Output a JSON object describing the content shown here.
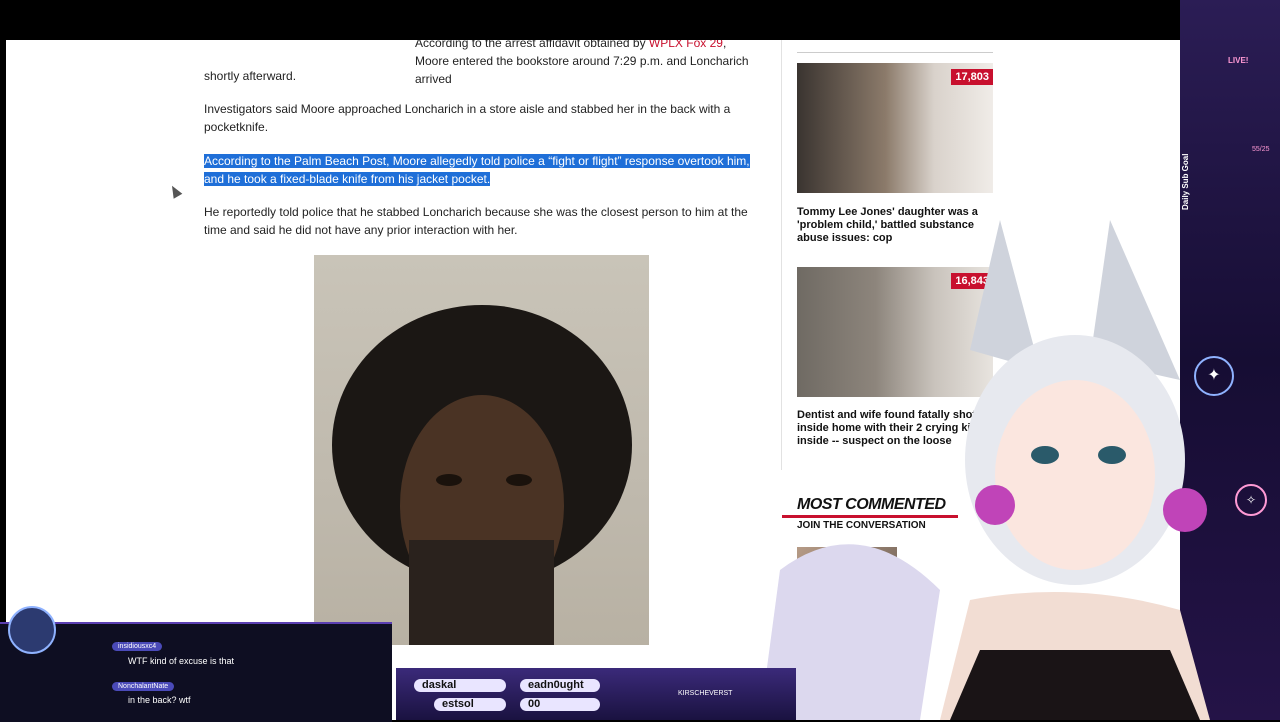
{
  "article": {
    "intro_prefix": "According to the arrest affidavit obtained by ",
    "intro_source": "WPLX Fox 29",
    "intro_middle": ", Moore entered the bookstore around 7:29 p.m. and Loncharich arrived",
    "intro_end": "shortly afterward.",
    "p2": "Investigators said Moore approached Loncharich in a store aisle and stabbed her in the back with a pocketknife.",
    "p3_line1": "According to the Palm Beach Post, Moore allegedly told police a “fight or flight” response overtook him,",
    "p3_line2": "and he took a fixed-blade knife from his jacket pocket.",
    "p4": "He reportedly told police that he stabbed Loncharich because she was the closest person to him at the time and said he did not have any prior interaction with her."
  },
  "sidebar": {
    "cards": [
      {
        "count": "17,803",
        "title": "Tommy Lee Jones' daughter was a 'problem child,' battled substance abuse issues: cop"
      },
      {
        "count": "16,843",
        "title": "Dentist and wife found fatally shot inside home with their 2 crying kids inside -- suspect on the loose"
      }
    ],
    "most_commented": {
      "title": "MOST COMMENTED",
      "subtitle": "JOIN THE CONVERSATION"
    }
  },
  "stream": {
    "live_label": "LIVE!",
    "sub_goal_label": "Daily Sub Goal",
    "sub_goal_count": "55/25",
    "chat": [
      {
        "user": "insidiousxc4",
        "message": "WTF kind of excuse is that"
      },
      {
        "user": "NonchalantNate",
        "message": "in the back? wtf"
      }
    ],
    "names": [
      "daskal",
      "eadn0ught",
      "estsol",
      "00"
    ],
    "channel": "KIRSCHEVERST"
  },
  "colors": {
    "highlight": "#1f6fd8",
    "badge": "#c8102e",
    "link": "#c8102e"
  }
}
